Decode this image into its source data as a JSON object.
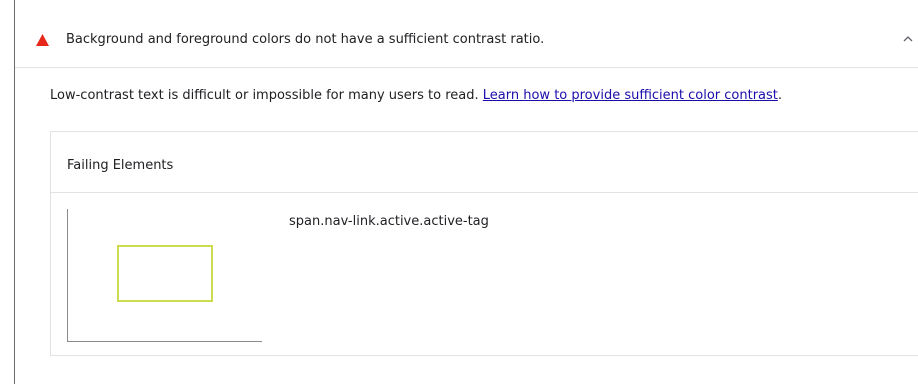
{
  "audit": {
    "title": "Background and foreground colors do not have a sufficient contrast ratio.",
    "status_icon": "warning-triangle-icon",
    "status_color": "#e8271b",
    "expand_icon": "chevron-up-icon"
  },
  "description": {
    "text": "Low-contrast text is difficult or impossible for many users to read. ",
    "link_text": "Learn how to provide sufficient color contrast",
    "trailing": "."
  },
  "failing_elements": {
    "header": "Failing Elements",
    "items": [
      {
        "selector": "span.nav-link.active.active-tag",
        "highlight_color": "#cddc4e"
      }
    ]
  }
}
